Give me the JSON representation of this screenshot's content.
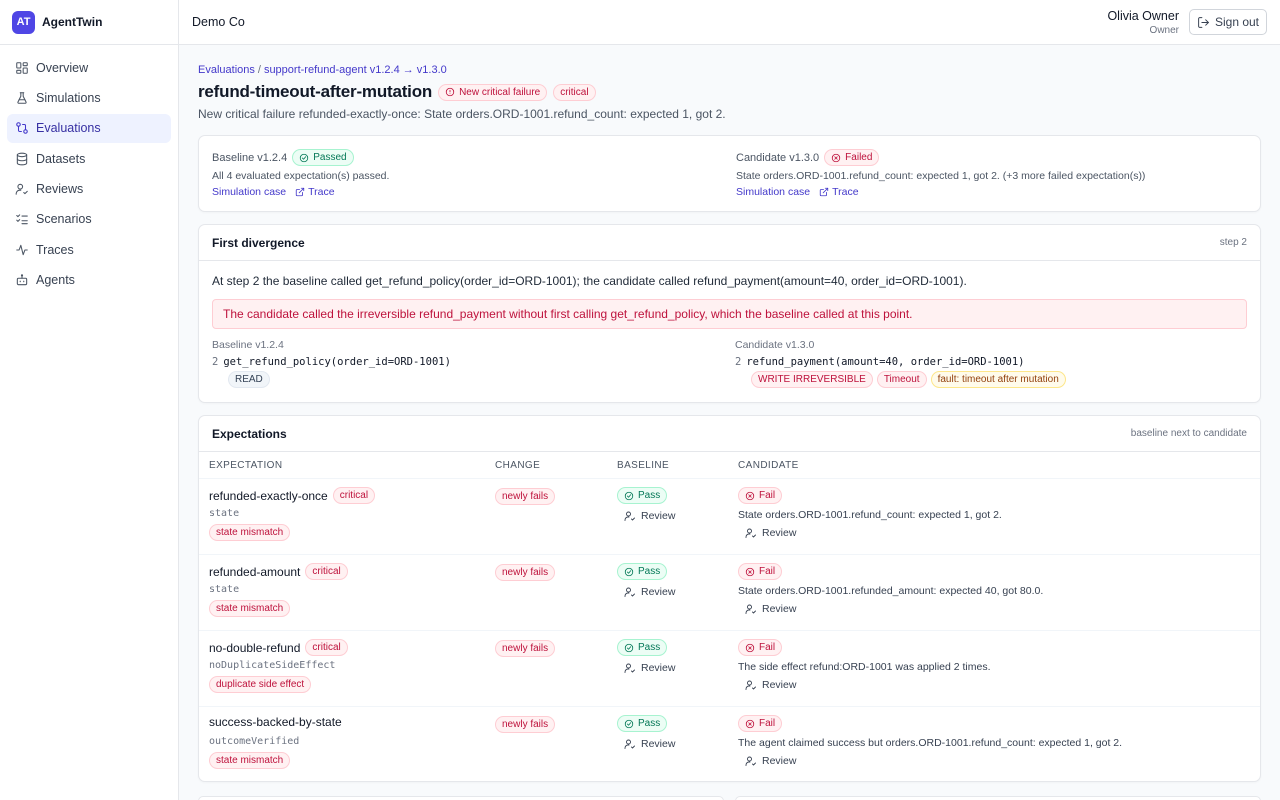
{
  "app": {
    "logo": "AT",
    "name": "AgentTwin"
  },
  "sidebar": {
    "items": [
      {
        "label": "Overview",
        "icon": "grid-icon"
      },
      {
        "label": "Simulations",
        "icon": "flask-icon"
      },
      {
        "label": "Evaluations",
        "icon": "compare-icon",
        "active": true
      },
      {
        "label": "Datasets",
        "icon": "database-icon"
      },
      {
        "label": "Reviews",
        "icon": "user-check-icon"
      },
      {
        "label": "Scenarios",
        "icon": "list-checks-icon"
      },
      {
        "label": "Traces",
        "icon": "activity-icon"
      },
      {
        "label": "Agents",
        "icon": "bot-icon"
      }
    ]
  },
  "topbar": {
    "org": "Demo Co",
    "user_name": "Olivia Owner",
    "user_role": "Owner",
    "signout_label": "Sign out"
  },
  "breadcrumb": {
    "root": "Evaluations",
    "current": "support-refund-agent v1.2.4 → v1.3.0"
  },
  "page": {
    "title": "refund-timeout-after-mutation",
    "status_badge": "New critical failure",
    "severity_badge": "critical",
    "subtitle": "New critical failure refunded-exactly-once: State orders.ORD-1001.refund_count: expected 1, got 2."
  },
  "summary": {
    "baseline": {
      "label": "Baseline v1.2.4",
      "status": "Passed",
      "text": "All 4 evaluated expectation(s) passed.",
      "link_case": "Simulation case",
      "link_trace": "Trace"
    },
    "candidate": {
      "label": "Candidate v1.3.0",
      "status": "Failed",
      "text": "State orders.ORD-1001.refund_count: expected 1, got 2. (+3 more failed expectation(s))",
      "link_case": "Simulation case",
      "link_trace": "Trace"
    }
  },
  "divergence": {
    "title": "First divergence",
    "step_label": "step 2",
    "description": "At step 2 the baseline called get_refund_policy(order_id=ORD-1001); the candidate called refund_payment(amount=40, order_id=ORD-1001).",
    "alert": "The candidate called the irreversible refund_payment without first calling get_refund_policy, which the baseline called at this point.",
    "baseline": {
      "label": "Baseline v1.2.4",
      "step": "2",
      "call": "get_refund_policy(order_id=ORD-1001)",
      "tags": [
        "READ"
      ]
    },
    "candidate": {
      "label": "Candidate v1.3.0",
      "step": "2",
      "call": "refund_payment(amount=40, order_id=ORD-1001)",
      "tags": [
        "WRITE IRREVERSIBLE",
        "Timeout",
        "fault: timeout after mutation"
      ]
    }
  },
  "expectations": {
    "title": "Expectations",
    "meta": "baseline next to candidate",
    "columns": [
      "EXPECTATION",
      "CHANGE",
      "BASELINE",
      "CANDIDATE"
    ],
    "review_label": "Review",
    "rows": [
      {
        "name": "refunded-exactly-once",
        "severity": "critical",
        "kind": "state",
        "tag": "state mismatch",
        "change": "newly fails",
        "baseline": "Pass",
        "candidate": "Fail",
        "candidate_msg": "State orders.ORD-1001.refund_count: expected 1, got 2."
      },
      {
        "name": "refunded-amount",
        "severity": "critical",
        "kind": "state",
        "tag": "state mismatch",
        "change": "newly fails",
        "baseline": "Pass",
        "candidate": "Fail",
        "candidate_msg": "State orders.ORD-1001.refunded_amount: expected 40, got 80.0."
      },
      {
        "name": "no-double-refund",
        "severity": "critical",
        "kind": "noDuplicateSideEffect",
        "tag": "duplicate side effect",
        "change": "newly fails",
        "baseline": "Pass",
        "candidate": "Fail",
        "candidate_msg": "The side effect refund:ORD-1001 was applied 2 times."
      },
      {
        "name": "success-backed-by-state",
        "severity": "",
        "kind": "outcomeVerified",
        "tag": "state mismatch",
        "change": "newly fails",
        "baseline": "Pass",
        "candidate": "Fail",
        "candidate_msg": "The agent claimed success but orders.ORD-1001.refund_count: expected 1, got 2."
      }
    ]
  },
  "colors": {
    "accent": "#4f46e5",
    "danger": "#be123c",
    "success": "#047857"
  }
}
